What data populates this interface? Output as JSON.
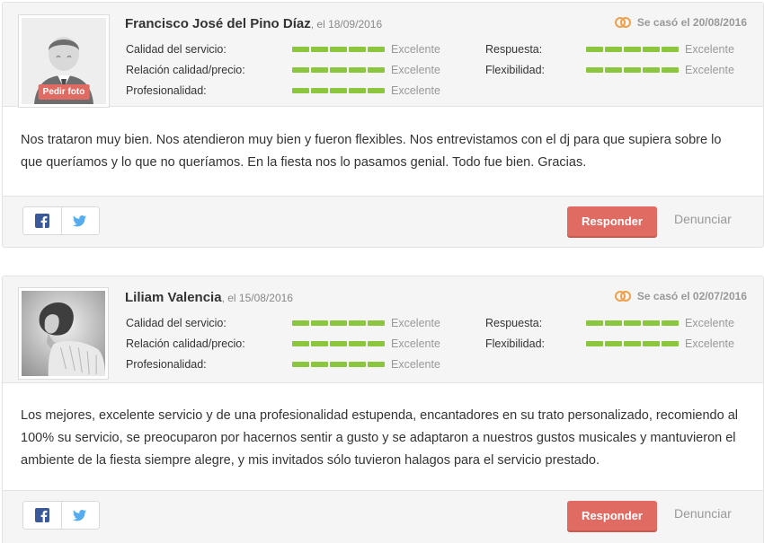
{
  "reviews": [
    {
      "name": "Francisco José del Pino Díaz",
      "date": ", el 18/09/2016",
      "married": "Se casó el 20/08/2016",
      "avatar_type": "placeholder",
      "avatar_button": "Pedir foto",
      "ratings_left": [
        {
          "label": "Calidad del servicio:",
          "value": "Excelente",
          "level": 5
        },
        {
          "label": "Relación calidad/precio:",
          "value": "Excelente",
          "level": 5
        },
        {
          "label": "Profesionalidad:",
          "value": "Excelente",
          "level": 5
        }
      ],
      "ratings_right": [
        {
          "label": "Respuesta:",
          "value": "Excelente",
          "level": 5
        },
        {
          "label": "Flexibilidad:",
          "value": "Excelente",
          "level": 5
        }
      ],
      "text": "Nos trataron muy bien. Nos atendieron muy bien y fueron flexibles. Nos entrevistamos con el dj para que supiera sobre lo que queríamos y lo que no queríamos. En la fiesta nos lo pasamos genial. Todo fue bien. Gracias.",
      "reply_label": "Responder",
      "report_label": "Denunciar"
    },
    {
      "name": "Liliam Valencia",
      "date": ", el 15/08/2016",
      "married": "Se casó el 02/07/2016",
      "avatar_type": "photo",
      "ratings_left": [
        {
          "label": "Calidad del servicio:",
          "value": "Excelente",
          "level": 5
        },
        {
          "label": "Relación calidad/precio:",
          "value": "Excelente",
          "level": 5
        },
        {
          "label": "Profesionalidad:",
          "value": "Excelente",
          "level": 5
        }
      ],
      "ratings_right": [
        {
          "label": "Respuesta:",
          "value": "Excelente",
          "level": 5
        },
        {
          "label": "Flexibilidad:",
          "value": "Excelente",
          "level": 5
        }
      ],
      "text": "Los mejores, excelente servicio y de una profesionalidad estupenda, encantadores en su trato personalizado, recomiendo al 100% su servicio, se preocuparon por hacernos sentir a gusto y se adaptaron a nuestros gustos musicales y mantuvieron el ambiente de la fiesta siempre alegre, y mis invitados sólo tuvieron halagos para el servicio prestado.",
      "reply_label": "Responder",
      "report_label": "Denunciar"
    }
  ],
  "icons": {
    "married": "wedding-rings-icon",
    "facebook": "facebook-icon",
    "twitter": "twitter-icon"
  },
  "colors": {
    "accent": "#e06b62",
    "rating_bar": "#8cc63f",
    "rings": "#f0a04b",
    "facebook": "#3b5998",
    "twitter": "#55acee"
  },
  "rating_max": 5
}
